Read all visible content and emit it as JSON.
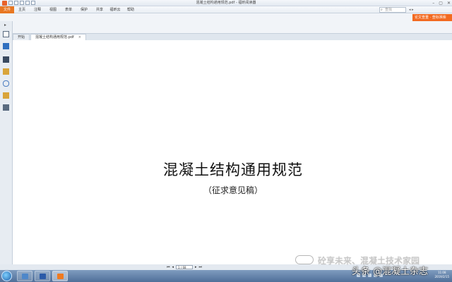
{
  "window": {
    "title": "混凝土结构通用规范.pdf - 福昕阅读器"
  },
  "menu": {
    "items": [
      "文件",
      "主页",
      "注释",
      "视图",
      "表单",
      "保护",
      "共享",
      "福昕云",
      "帮助"
    ]
  },
  "search": {
    "placeholder": "查找"
  },
  "promo": {
    "label": "论文查重 · 查标准库"
  },
  "tabs": [
    {
      "label": "开始"
    },
    {
      "label": "混凝土结构通用规范.pdf"
    }
  ],
  "document": {
    "title": "混凝土结构通用规范",
    "subtitle": "（征求意见稿）"
  },
  "zoom_widget": {
    "value": "47",
    "unit": "%",
    "up_speed": "0k/s",
    "down_speed": "0.4k/s"
  },
  "page_nav": {
    "page_input": "1 / 68"
  },
  "taskbar": {
    "time": "11:08",
    "date": "2019/2/15"
  },
  "watermark": {
    "line1": "砼享未来、混凝土技术家园",
    "line2": "头条 @混凝土杂志"
  },
  "colors": {
    "accent": "#e87722",
    "promo": "#f26a21",
    "taskbar": "#4f6f99"
  }
}
